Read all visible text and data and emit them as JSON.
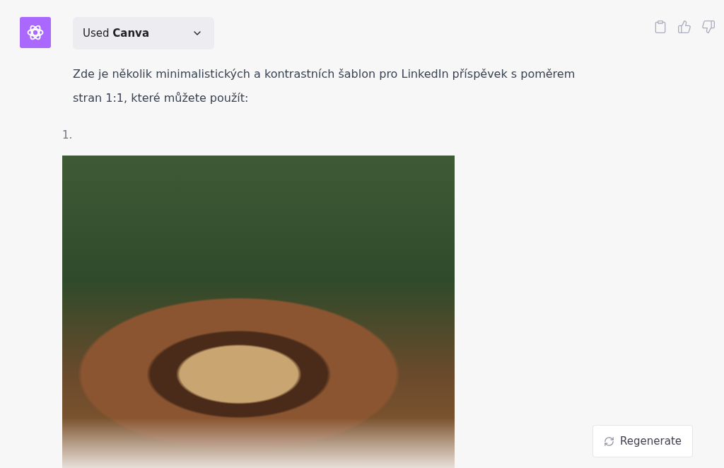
{
  "message": {
    "tool": {
      "label": "Used **Canva**",
      "expanded": false
    },
    "text": "Zde je několik minimalistických a kontrastních šablon pro LinkedIn příspěvek s poměrem stran 1:1, které můžete použít:",
    "list": [
      {
        "marker": "1."
      }
    ]
  },
  "regenerate": {
    "label": "Regenerate"
  }
}
